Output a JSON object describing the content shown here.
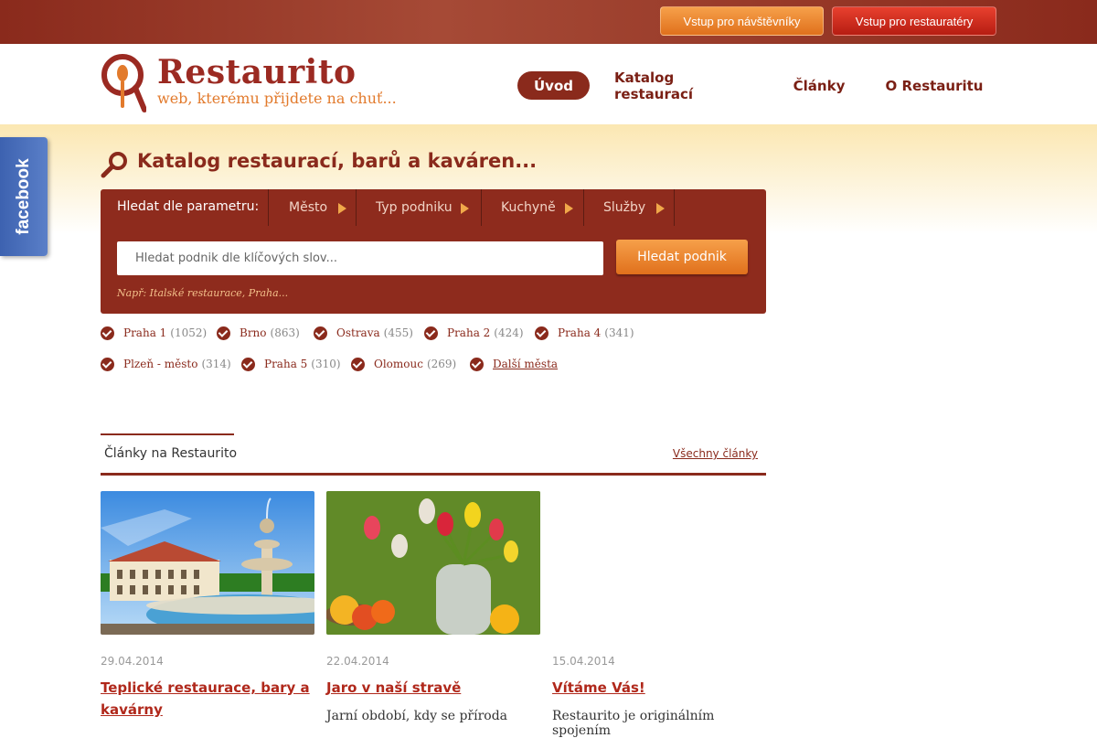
{
  "topbar": {
    "visitor_button": "Vstup pro návštěvníky",
    "restaurateur_button": "Vstup pro restauratéry"
  },
  "logo": {
    "title": "Restaurito",
    "subtitle": "web, kterému přijdete na chuť..."
  },
  "nav": {
    "items": [
      {
        "label": "Úvod"
      },
      {
        "label": "Katalog restaurací"
      },
      {
        "label": "Články"
      },
      {
        "label": "O Restauritu"
      }
    ]
  },
  "facebook": {
    "label": "facebook"
  },
  "catalog": {
    "heading": "Katalog restaurací, barů a kaváren...",
    "filter_label": "Hledat dle parametru:",
    "filters": [
      "Město",
      "Typ podniku",
      "Kuchyně",
      "Služby"
    ],
    "search_placeholder": "Hledat podnik dle klíčových slov...",
    "search_button": "Hledat podnik",
    "hint": "Např: Italské restaurace, Praha..."
  },
  "cities": [
    {
      "name": "Praha 1",
      "count": "(1052)"
    },
    {
      "name": "Brno",
      "count": "(863)"
    },
    {
      "name": "Ostrava",
      "count": "(455)"
    },
    {
      "name": "Praha 2",
      "count": "(424)"
    },
    {
      "name": "Praha 4",
      "count": "(341)"
    },
    {
      "name": "Plzeň - město",
      "count": "(314)"
    },
    {
      "name": "Praha 5",
      "count": "(310)"
    },
    {
      "name": "Olomouc",
      "count": "(269)"
    },
    {
      "name": "Další města",
      "count": ""
    }
  ],
  "articles": {
    "section_title": "Články na Restaurito",
    "all_link": "Všechny články",
    "items": [
      {
        "date": "29.04.2014",
        "title": "Teplické restaurace, bary a kavárny",
        "text": ""
      },
      {
        "date": "22.04.2014",
        "title": "Jaro v naší stravě",
        "text": "Jarní období, kdy se příroda"
      },
      {
        "date": "15.04.2014",
        "title": "Vítáme Vás!",
        "text": "Restaurito je originálním spojením"
      }
    ]
  },
  "colors": {
    "brand": "#8a2a1c",
    "accent": "#e27a2c"
  }
}
